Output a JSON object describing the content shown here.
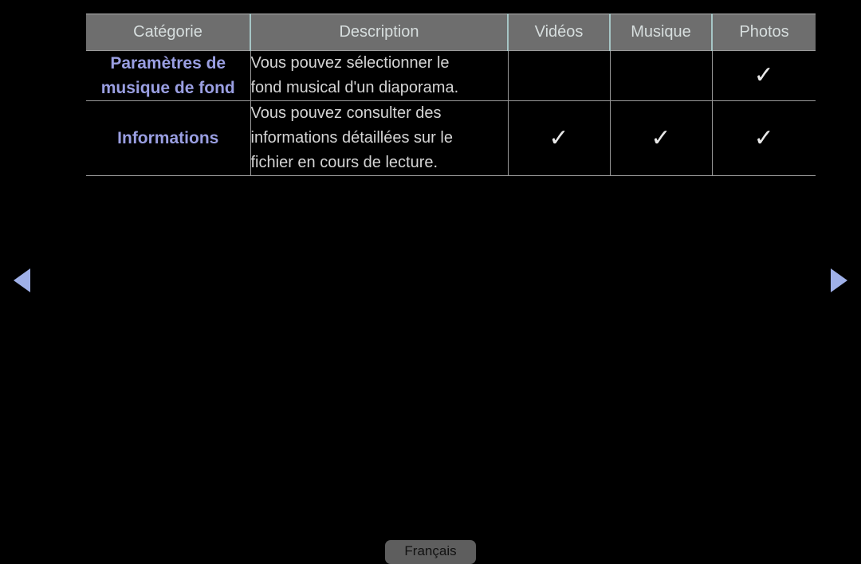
{
  "table": {
    "headers": [
      {
        "label": "Catégorie"
      },
      {
        "label": "Description"
      },
      {
        "label": "Vidéos"
      },
      {
        "label": "Musique"
      },
      {
        "label": "Photos"
      }
    ],
    "rows": [
      {
        "category": "Paramètres de musique de fond",
        "description": "Vous pouvez sélectionner le\nfond musical d'un diaporama.",
        "videos": "",
        "musique": "",
        "photos": "✓"
      },
      {
        "category": "Informations",
        "description": "Vous pouvez consulter des\ninformations détaillées sur le\nfichier en cours de lecture.",
        "videos": "✓",
        "musique": "✓",
        "photos": "✓"
      }
    ]
  },
  "navigation": {
    "previous": {
      "icon": "triangle-left-icon",
      "label": "◀"
    },
    "next": {
      "icon": "triangle-right-icon",
      "label": "▶"
    }
  },
  "footer": {
    "language_label": "Français"
  },
  "colors": {
    "background": "#000000",
    "header_bg": "#6e6e6e",
    "header_text": "#d7dede",
    "header_divider": "#a6c6c6",
    "body_divider": "#9a9a9a",
    "category_text": "#9a9fe2",
    "description_text": "#d5d5d5",
    "check_mark": "#e8e8e8",
    "arrow": "#9fb0e8",
    "language_button_bg": "#5e5e5e",
    "language_button_text": "#111111"
  }
}
